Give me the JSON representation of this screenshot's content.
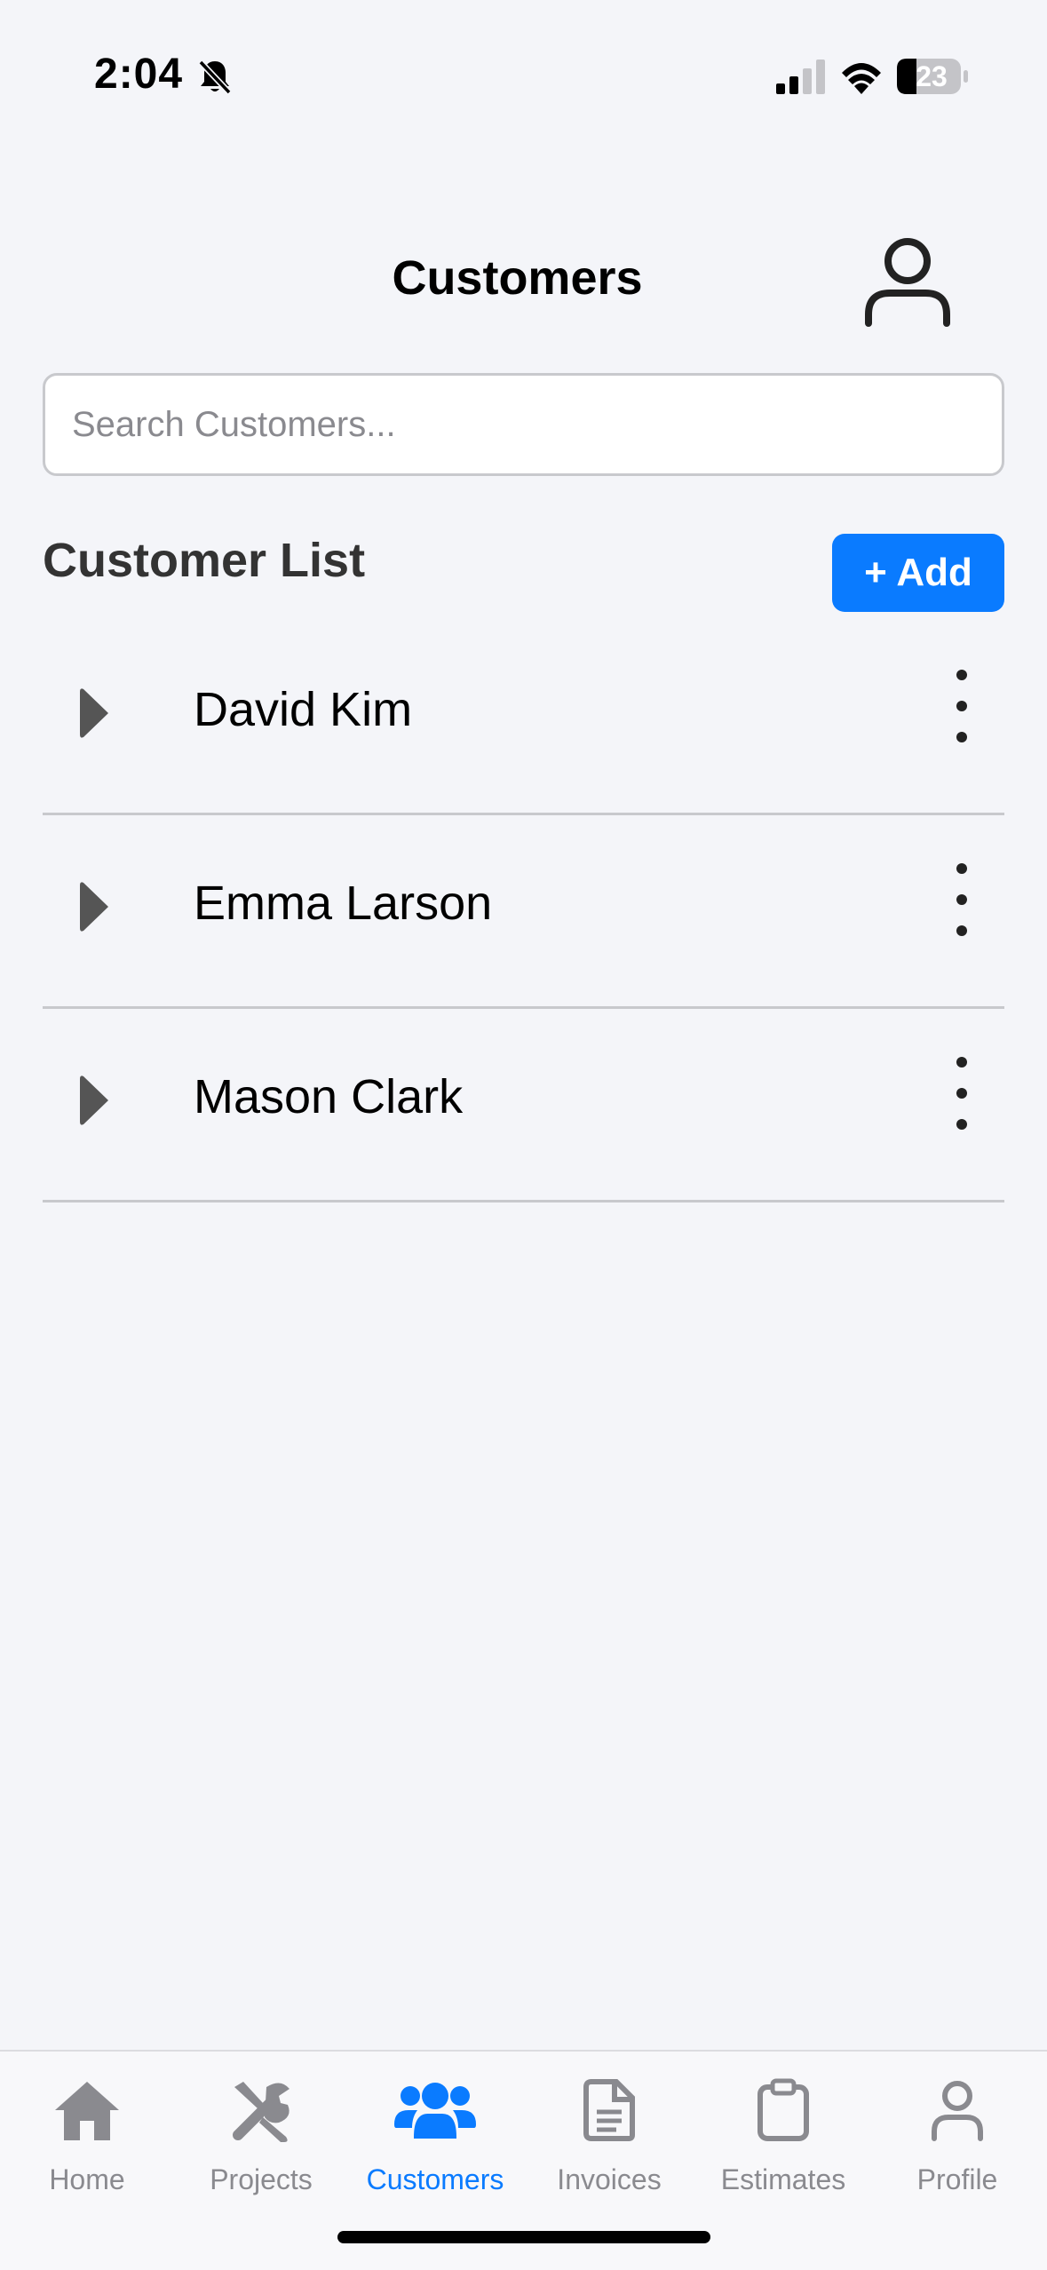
{
  "status_bar": {
    "time": "2:04",
    "battery_level": "23",
    "icons": [
      "bell-off-icon",
      "cellular-signal-icon",
      "wifi-icon",
      "battery-icon"
    ]
  },
  "header": {
    "title": "Customers",
    "user_icon": "user-icon"
  },
  "search": {
    "placeholder": "Search Customers...",
    "value": ""
  },
  "section": {
    "title": "Customer List",
    "add_label": "+ Add"
  },
  "customers": [
    {
      "name": "David Kim"
    },
    {
      "name": "Emma Larson"
    },
    {
      "name": "Mason Clark"
    }
  ],
  "tabs": [
    {
      "label": "Home",
      "icon": "home-icon",
      "active": false
    },
    {
      "label": "Projects",
      "icon": "tools-icon",
      "active": false
    },
    {
      "label": "Customers",
      "icon": "users-icon",
      "active": true
    },
    {
      "label": "Invoices",
      "icon": "document-icon",
      "active": false
    },
    {
      "label": "Estimates",
      "icon": "clipboard-icon",
      "active": false
    },
    {
      "label": "Profile",
      "icon": "user-icon",
      "active": false
    }
  ],
  "colors": {
    "accent": "#0a7bff",
    "background": "#f4f5f9",
    "inactive_tab": "#8a8a8f",
    "divider": "#c8c9cd"
  }
}
